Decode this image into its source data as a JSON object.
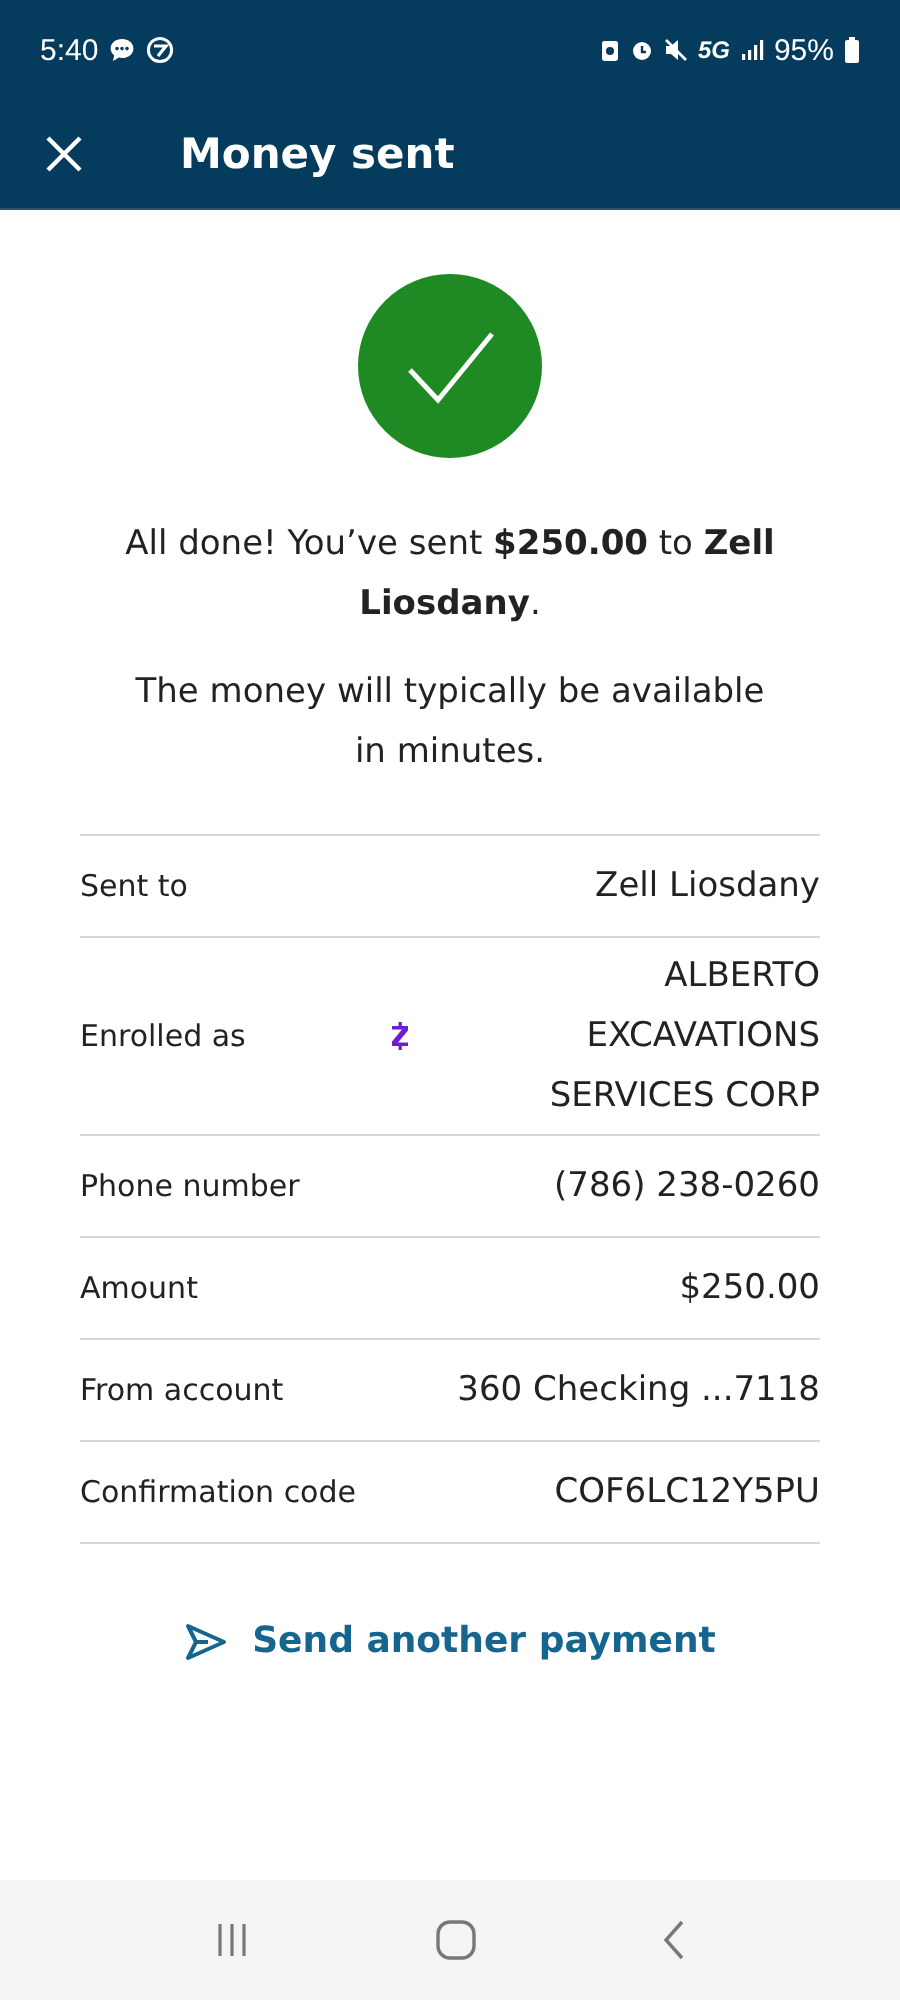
{
  "status_bar": {
    "time": "5:40",
    "network": "5G",
    "battery": "95%"
  },
  "header": {
    "title": "Money sent"
  },
  "message": "All done! You’ve sent **$250.00** to **Zell Liosdany**.",
  "note": "The money will typically be available in minutes.",
  "details": [
    {
      "kind": "plain",
      "label": "Sent to",
      "value": "Zell Liosdany"
    },
    {
      "kind": "zelle",
      "label": "Enrolled as",
      "value": "ALBERTO EXCAVATIONS SERVICES CORP"
    },
    {
      "kind": "plain",
      "label": "Phone number",
      "value": "(786) 238-0260"
    },
    {
      "kind": "plain",
      "label": "Amount",
      "value": "$250.00"
    },
    {
      "kind": "plain",
      "label": "From account",
      "value": "360 Checking ...7118"
    },
    {
      "kind": "plain",
      "label": "Confirmation code",
      "value": "COF6LC12Y5PU"
    }
  ],
  "action": {
    "label": "Send another payment"
  }
}
